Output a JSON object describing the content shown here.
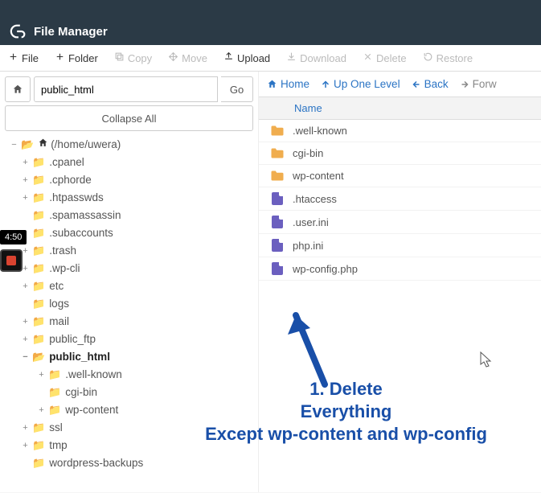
{
  "header": {
    "title": "File Manager"
  },
  "toolbar": [
    {
      "label": "File",
      "enabled": true,
      "icon": "plus"
    },
    {
      "label": "Folder",
      "enabled": true,
      "icon": "plus"
    },
    {
      "label": "Copy",
      "enabled": false,
      "icon": "copy"
    },
    {
      "label": "Move",
      "enabled": false,
      "icon": "move"
    },
    {
      "label": "Upload",
      "enabled": true,
      "icon": "upload"
    },
    {
      "label": "Download",
      "enabled": false,
      "icon": "download"
    },
    {
      "label": "Delete",
      "enabled": false,
      "icon": "delete"
    },
    {
      "label": "Restore",
      "enabled": false,
      "icon": "restore"
    }
  ],
  "left": {
    "path_value": "public_html",
    "go_label": "Go",
    "collapse_label": "Collapse All",
    "root_label": "(/home/uwera)",
    "tree": [
      {
        "name": ".cpanel",
        "expand": true
      },
      {
        "name": ".cphorde",
        "expand": true
      },
      {
        "name": ".htpasswds",
        "expand": true
      },
      {
        "name": ".spamassassin",
        "expand": false
      },
      {
        "name": ".subaccounts",
        "expand": false
      },
      {
        "name": ".trash",
        "expand": true
      },
      {
        "name": ".wp-cli",
        "expand": true
      },
      {
        "name": "etc",
        "expand": true
      },
      {
        "name": "logs",
        "expand": false
      },
      {
        "name": "mail",
        "expand": true
      },
      {
        "name": "public_ftp",
        "expand": true
      }
    ],
    "public_html_label": "public_html",
    "public_html_children": [
      {
        "name": ".well-known",
        "expand": true
      },
      {
        "name": "cgi-bin",
        "expand": false
      },
      {
        "name": "wp-content",
        "expand": true
      }
    ],
    "tree_after": [
      {
        "name": "ssl",
        "expand": true
      },
      {
        "name": "tmp",
        "expand": true
      },
      {
        "name": "wordpress-backups",
        "expand": false
      }
    ]
  },
  "right": {
    "nav": {
      "home": "Home",
      "up": "Up One Level",
      "back": "Back",
      "forward": "Forw"
    },
    "name_header": "Name",
    "files": [
      {
        "name": ".well-known",
        "type": "folder"
      },
      {
        "name": "cgi-bin",
        "type": "folder"
      },
      {
        "name": "wp-content",
        "type": "folder"
      },
      {
        "name": ".htaccess",
        "type": "file"
      },
      {
        "name": ".user.ini",
        "type": "file"
      },
      {
        "name": "php.ini",
        "type": "file"
      },
      {
        "name": "wp-config.php",
        "type": "file"
      }
    ]
  },
  "annotation": {
    "line1": "1. Delete",
    "line2": "Everything",
    "line3": "Except wp-content and wp-config"
  },
  "overlay": {
    "time_tag": "4:50"
  }
}
